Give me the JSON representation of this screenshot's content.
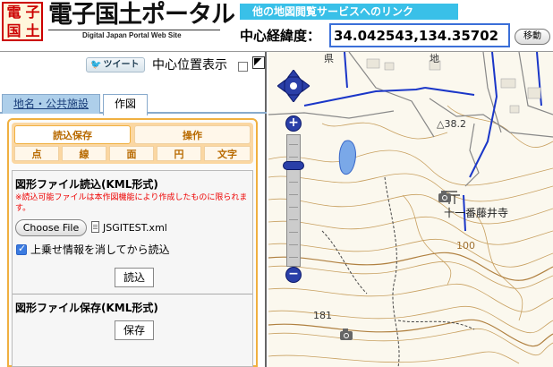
{
  "header": {
    "logo_chars": [
      "電",
      "子",
      "国",
      "土"
    ],
    "site_title": "電子国土ポータル",
    "site_subtitle": "Digital Japan Portal Web Site",
    "link_banner": "他の地図閲覧サービスへのリンク",
    "center_label": "中心経緯度：",
    "center_value": "34.042543,134.35702",
    "move_button": "移動"
  },
  "sidebar": {
    "tweet_label": "ツイート",
    "tweet_icon": "twitter-bird-icon",
    "center_display_label": "中心位置表示",
    "collapse_icon": "collapse-arrow-icon",
    "tabs": [
      {
        "label": "地名・公共施設",
        "active": false
      },
      {
        "label": "作図",
        "active": true
      }
    ],
    "subtabs_top": [
      {
        "label": "読込保存",
        "active": true
      },
      {
        "label": "操作",
        "active": false
      }
    ],
    "subtabs_shapes": [
      {
        "label": "点"
      },
      {
        "label": "線"
      },
      {
        "label": "面"
      },
      {
        "label": "円"
      },
      {
        "label": "文字"
      }
    ],
    "read_heading": "図形ファイル読込(KML形式)",
    "read_note": "※読込可能ファイルは本作図機能により作成したものに限られます。",
    "choose_file_label": "Choose File",
    "file_name": "JSGITEST.xml",
    "overlay_clear_label": "上乗せ情報を消してから読込",
    "overlay_clear_checked": true,
    "read_button": "読込",
    "save_heading": "図形ファイル保存(KML形式)",
    "save_button": "保存"
  },
  "map": {
    "labels": {
      "top_a": "県",
      "top_b": "地",
      "elevation": "△38.2",
      "place": "十一番藤井寺",
      "contour": "100",
      "bottom_mark": "181"
    },
    "colors": {
      "road": "#1a36c8",
      "contour": "#c8a060",
      "water": "#7aa8e8",
      "control": "#2a3fa8"
    }
  }
}
